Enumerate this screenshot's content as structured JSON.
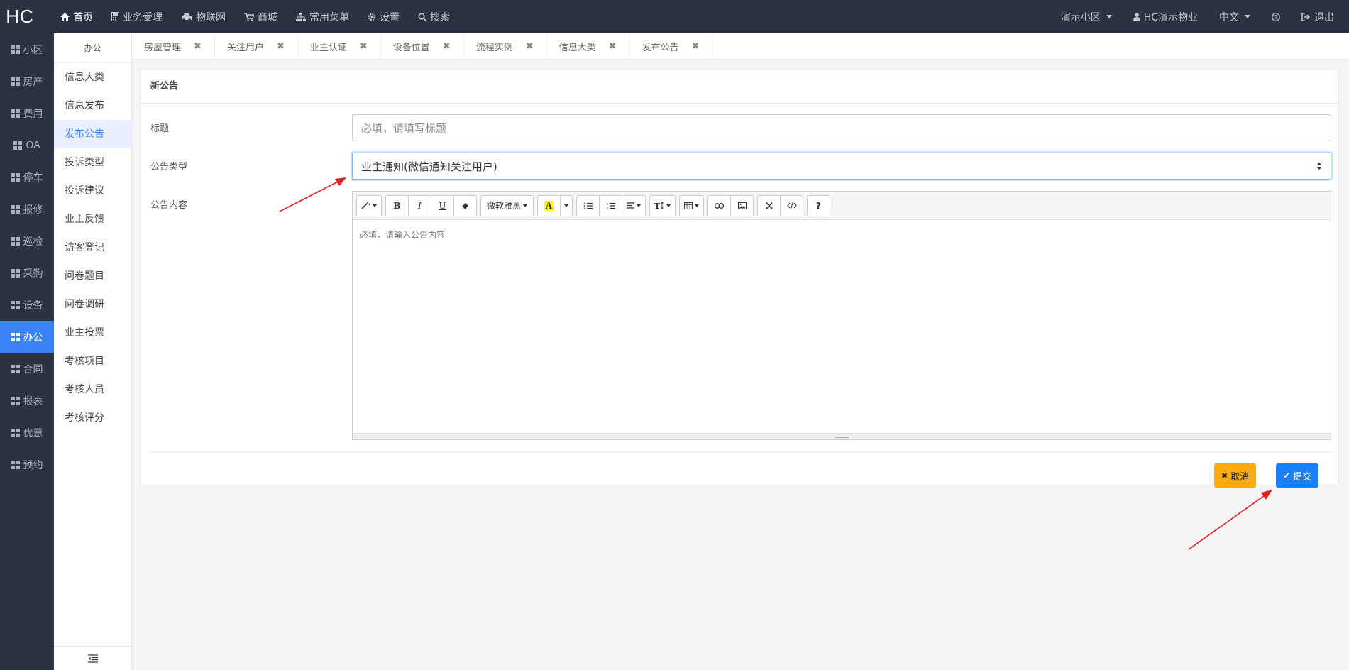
{
  "topbar": {
    "logo": "HC",
    "nav": [
      {
        "label": "首页",
        "icon": "home-icon"
      },
      {
        "label": "业务受理",
        "icon": "calculator-icon"
      },
      {
        "label": "物联网",
        "icon": "car-icon"
      },
      {
        "label": "商城",
        "icon": "cart-icon"
      },
      {
        "label": "常用菜单",
        "icon": "sitemap-icon"
      },
      {
        "label": "设置",
        "icon": "gear-icon"
      },
      {
        "label": "搜索",
        "icon": "search-icon"
      }
    ],
    "right": {
      "community": "演示小区",
      "user": "HC演示物业",
      "language": "中文",
      "logout": "退出"
    }
  },
  "sidebar": {
    "items": [
      "小区",
      "房产",
      "费用",
      "OA",
      "停车",
      "报修",
      "巡检",
      "采购",
      "设备",
      "办公",
      "合同",
      "报表",
      "优惠",
      "预约"
    ],
    "active": "办公"
  },
  "submenu": {
    "title": "办公",
    "items": [
      "信息大类",
      "信息发布",
      "发布公告",
      "投诉类型",
      "投诉建议",
      "业主反馈",
      "访客登记",
      "问卷题目",
      "问卷调研",
      "业主投票",
      "考核项目",
      "考核人员",
      "考核评分"
    ],
    "active": "发布公告"
  },
  "tabs": [
    "房屋管理",
    "关注用户",
    "业主认证",
    "设备位置",
    "流程实例",
    "信息大类",
    "发布公告"
  ],
  "form": {
    "panel_title": "新公告",
    "title_label": "标题",
    "title_placeholder": "必填，请填写标题",
    "type_label": "公告类型",
    "type_value": "业主通知(微信通知关注用户)",
    "content_label": "公告内容",
    "content_placeholder": "必填，请输入公告内容",
    "font_name": "微软雅黑",
    "cancel_label": "取消",
    "submit_label": "提交"
  },
  "colors": {
    "topbar_bg": "#2b3241",
    "accent": "#3a83f7",
    "cancel": "#f8ac10",
    "submit": "#1a7ff5",
    "annotation_arrow": "#e02020"
  }
}
